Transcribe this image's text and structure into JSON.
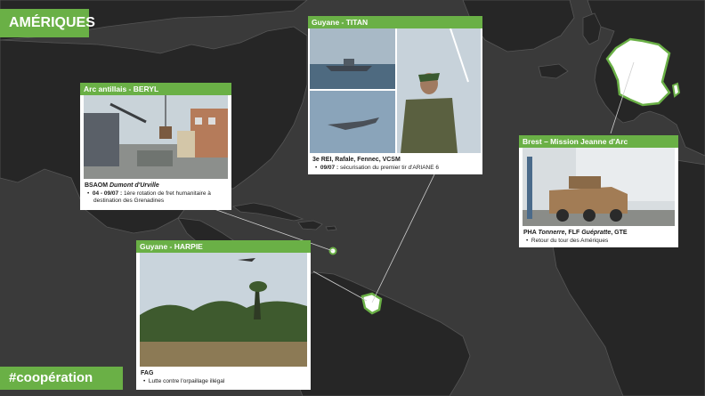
{
  "region_label": "AMÉRIQUES",
  "hashtag": "#coopération",
  "colors": {
    "accent": "#6ab046",
    "ocean": "#3a3a3a",
    "land": "#262626",
    "country_border": "#555555",
    "highlight": "#ffffff"
  },
  "cards": {
    "beryl": {
      "header": "Arc antillais - BERYL",
      "title_prefix": "BSAOM ",
      "title_ship": "Dumont d'Urville",
      "bullet_dates": "04 - 09/07 :",
      "bullet_text": " 1ère rotation de fret humanitaire à destination des Grenadines"
    },
    "titan": {
      "header": "Guyane - TITAN",
      "title": "3e REI, Rafale, Fennec, VCSM",
      "bullet_dates": "09/07 :",
      "bullet_text": " sécurisation du premier tir d'ARIANE 6"
    },
    "jeanne": {
      "header": "Brest – Mission Jeanne d'Arc",
      "title_prefix": "PHA ",
      "title_ship1": "Tonnerre",
      "title_mid": ", FLF ",
      "title_ship2": "Guépratte",
      "title_suffix": ", GTE",
      "bullet_text": "Retour du tour des Amériques"
    },
    "harpie": {
      "header": "Guyane - HARPIE",
      "title": "FAG",
      "bullet_text": "Lutte contre l'orpaillage illégal"
    }
  }
}
